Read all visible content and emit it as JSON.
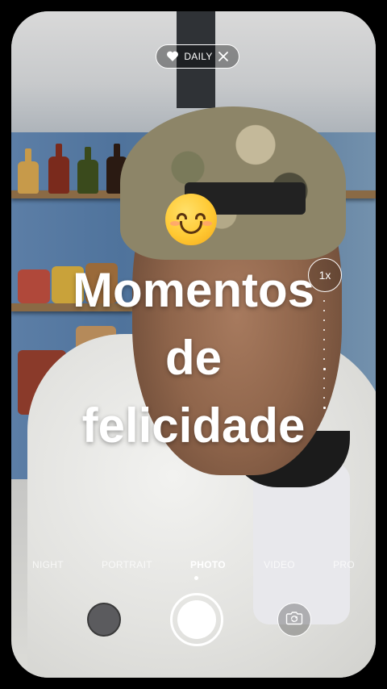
{
  "header": {
    "daily_pill": {
      "label": "DAILY",
      "icon_left": "heart-icon",
      "icon_right": "close-icon"
    }
  },
  "sticker": {
    "emoji": "😊",
    "icon": "smiling-face-icon"
  },
  "caption": {
    "text": "Momentos\nde\nfelicidade"
  },
  "zoom": {
    "label": "1x"
  },
  "modes": {
    "items": [
      "NIGHT",
      "PORTRAIT",
      "PHOTO",
      "VIDEO",
      "PRO"
    ],
    "selected": "PHOTO"
  },
  "controls": {
    "gallery_icon": "gallery-thumbnail",
    "shutter_icon": "shutter-button",
    "flip_icon": "camera-flip-icon"
  },
  "colors": {
    "accent": "#ffffff",
    "background": "#000000"
  }
}
